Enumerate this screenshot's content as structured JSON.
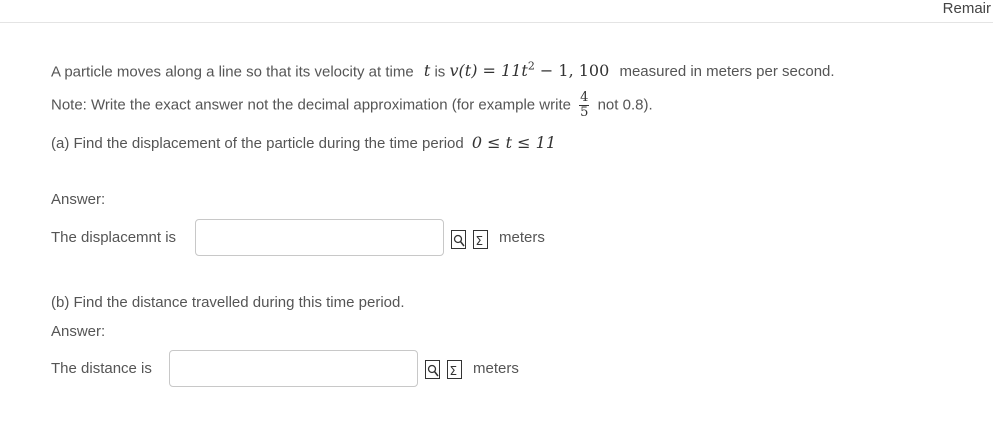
{
  "header": {
    "timer_label": "Remair"
  },
  "question": {
    "intro_prefix": "A particle moves along a line so that its velocity at time",
    "t": "t",
    "is": "is",
    "velocity_lhs": "v(t) = 11t",
    "velocity_exp": "2",
    "velocity_rhs": " − 1, 100",
    "intro_suffix": "measured in meters per second.",
    "note_prefix": "Note: Write the exact answer not the decimal approximation (for example write",
    "note_frac_num": "4",
    "note_frac_den": "5",
    "note_suffix": "not 0.8).",
    "part_a_text": "(a) Find the displacement of the particle during the time period",
    "part_a_interval": "0 ≤ t ≤ 11",
    "part_b_text": "(b) Find the distance travelled during this time period."
  },
  "part_a": {
    "answer_label": "Answer:",
    "field_label": "The displacemnt is",
    "value": "",
    "unit": "meters"
  },
  "part_b": {
    "answer_label": "Answer:",
    "field_label": "The distance is",
    "value": "",
    "unit": "meters"
  },
  "icons": {
    "preview": "preview-icon",
    "equation_editor": "equation-editor-icon"
  }
}
